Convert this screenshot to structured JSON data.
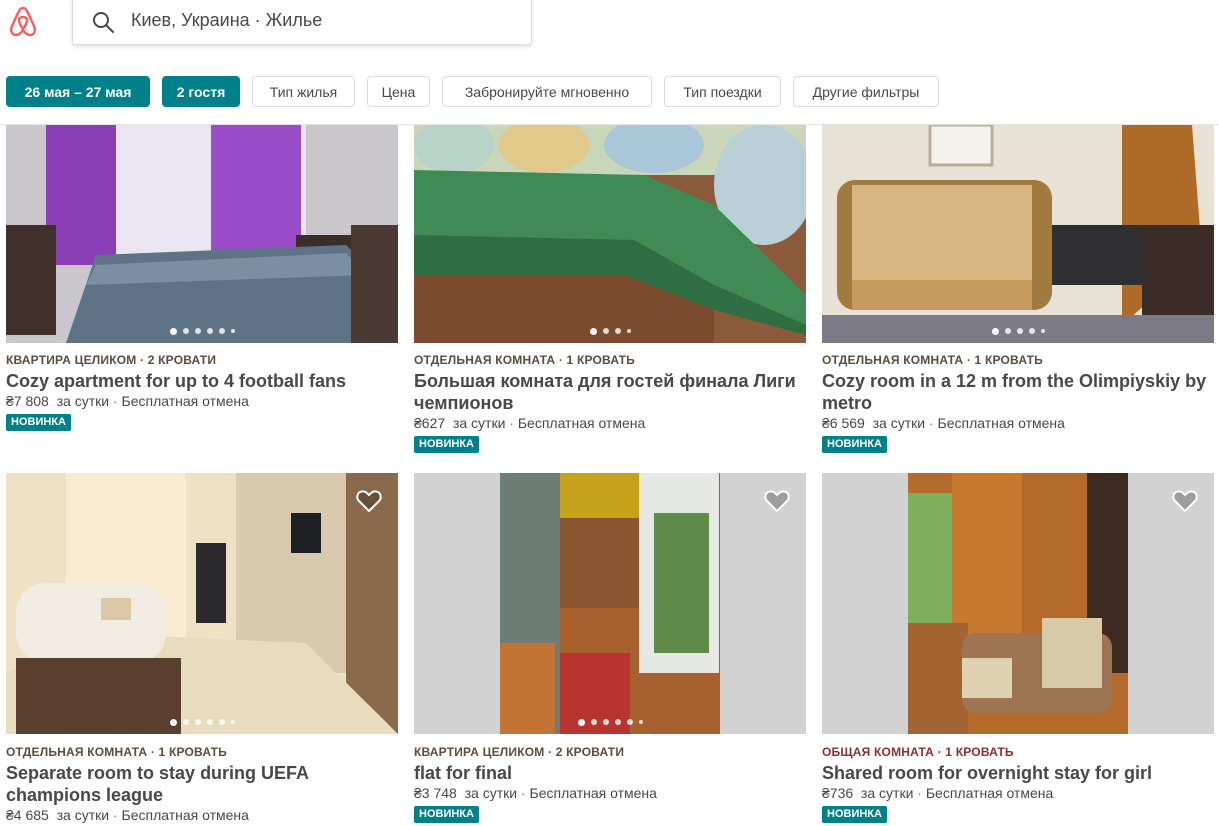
{
  "search": {
    "text": "Киев, Украина · Жилье"
  },
  "filters": {
    "dates": "26 мая – 27 мая",
    "guests": "2 гостя",
    "home_type": "Тип жилья",
    "price": "Цена",
    "instant_book": "Забронируйте мгновенно",
    "trip_type": "Тип поездки",
    "more_filters": "Другие фильтры"
  },
  "colors": {
    "accent": "#00818a",
    "brand": "#ff5a5f"
  },
  "listings": [
    {
      "meta": "КВАРТИРА ЦЕЛИКОМ · 2 КРОВАТИ",
      "title": "Cozy apartment for up to 4 football fans",
      "price": "₴7 808",
      "per": "за сутки",
      "cancel": "Бесплатная отмена",
      "badge": "НОВИНКА"
    },
    {
      "meta": "ОТДЕЛЬНАЯ КОМНАТА · 1 КРОВАТЬ",
      "title": "Большая комната для гостей финала Лиги чемпионов",
      "price": "₴627",
      "per": "за сутки",
      "cancel": "Бесплатная отмена",
      "badge": "НОВИНКА"
    },
    {
      "meta": "ОТДЕЛЬНАЯ КОМНАТА · 1 КРОВАТЬ",
      "title": "Cozy room in a 12 m from the Olimpiyskiy by metro",
      "price": "₴6 569",
      "per": "за сутки",
      "cancel": "Бесплатная отмена",
      "badge": "НОВИНКА"
    },
    {
      "meta": "ОТДЕЛЬНАЯ КОМНАТА · 1 КРОВАТЬ",
      "title": "Separate room to stay during UEFA champions league",
      "price": "₴4 685",
      "per": "за сутки",
      "cancel": "Бесплатная отмена",
      "badge": ""
    },
    {
      "meta": "КВАРТИРА ЦЕЛИКОМ · 2 КРОВАТИ",
      "title": "flat for final",
      "price": "₴3 748",
      "per": "за сутки",
      "cancel": "Бесплатная отмена",
      "badge": "НОВИНКА"
    },
    {
      "meta": "ОБЩАЯ КОМНАТА · 1 КРОВАТЬ",
      "title": "Shared room for overnight stay for girl",
      "price": "₴736",
      "per": "за сутки",
      "cancel": "Бесплатная отмена",
      "badge": "НОВИНКА"
    }
  ]
}
